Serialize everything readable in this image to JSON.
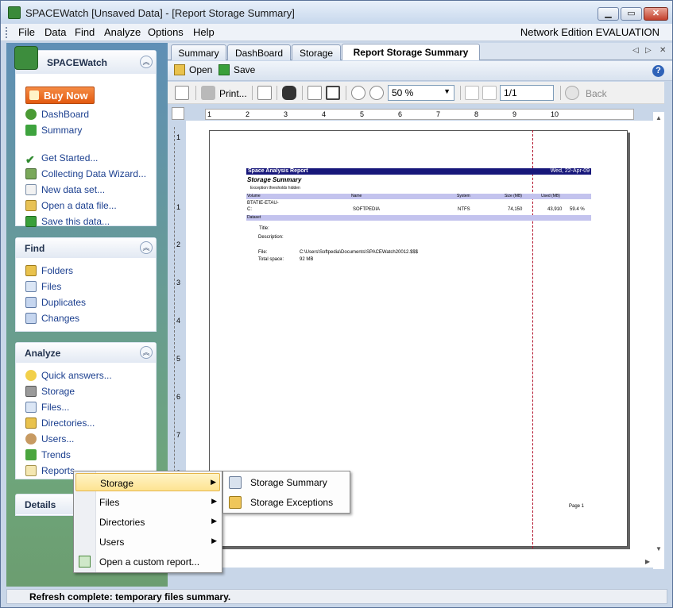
{
  "window": {
    "title": "SPACEWatch [Unsaved Data] - [Report Storage Summary]",
    "min_glyph": "▁",
    "max_glyph": "▭",
    "close_glyph": "✕"
  },
  "menubar": {
    "items": [
      "File",
      "Data",
      "Find",
      "Analyze",
      "Options",
      "Help"
    ],
    "edition": "Network Edition EVALUATION"
  },
  "sidebar": {
    "app_panel": {
      "title": "SPACEWatch",
      "buy_now": "Buy Now",
      "links": [
        "DashBoard",
        "Summary",
        "Get Started...",
        "Collecting Data Wizard...",
        "New data set...",
        "Open a data file...",
        "Save this data..."
      ]
    },
    "find_panel": {
      "title": "Find",
      "links": [
        "Folders",
        "Files",
        "Duplicates",
        "Changes"
      ]
    },
    "analyze_panel": {
      "title": "Analyze",
      "links": [
        "Quick answers...",
        "Storage",
        "Files...",
        "Directories...",
        "Users...",
        "Trends",
        "Reports"
      ]
    },
    "details_panel": {
      "title": "Details"
    },
    "collapse_glyph": "︽"
  },
  "tabs": {
    "items": [
      "Summary",
      "DashBoard",
      "Storage",
      "Report Storage Summary"
    ],
    "active": "Report Storage Summary",
    "prev_glyph": "◁",
    "next_glyph": "▷",
    "close_glyph": "✕"
  },
  "toolbar": {
    "open": "Open",
    "save": "Save",
    "help_glyph": "?"
  },
  "preview_toolbar": {
    "print": "Print...",
    "zoom": "50 %",
    "page": "1/1",
    "back": "Back",
    "dropdown_glyph": "▼"
  },
  "ruler": {
    "marks": [
      "1",
      "2",
      "3",
      "4",
      "5",
      "6",
      "7",
      "8",
      "9",
      "10"
    ],
    "vmarks": [
      "1",
      "2",
      "3",
      "4",
      "5",
      "6",
      "7",
      "8",
      "9"
    ]
  },
  "report": {
    "title": "Space Analysis Report",
    "date": "Wed, 22-Apr-09",
    "subtitle": "Storage Summary",
    "note": "Exception thresholds hidden",
    "columns": [
      "Volume",
      "Name",
      "System",
      "Size (MB)",
      "Used (MB)"
    ],
    "row_volume_1": "BTATIE-ETAU-",
    "row_volume_2": "C:",
    "row_name": "SOFTPEDIA",
    "row_system": "NTFS",
    "row_size": "74,150",
    "row_used": "43,910",
    "row_pct": "59.4 %",
    "dataset_label": "Dataset",
    "title_label": "Title:",
    "description_label": "Description:",
    "file_label": "File:",
    "file_value": "C:\\Users\\Softpedia\\Documents\\SPACEWatch20012.$$$",
    "total_label": "Total space:",
    "total_value": "92 MB",
    "page_label": "Page 1"
  },
  "context_menu": {
    "items": [
      "Storage",
      "Files",
      "Directories",
      "Users",
      "Open a custom report..."
    ],
    "sub_glyph": "▶"
  },
  "submenu": {
    "items": [
      "Storage Summary",
      "Storage Exceptions"
    ]
  },
  "scroll": {
    "up_glyph": "▲",
    "down_glyph": "▼",
    "left_glyph": "◀",
    "right_glyph": "▶"
  },
  "status": {
    "text": "Refresh complete: temporary files summary."
  }
}
